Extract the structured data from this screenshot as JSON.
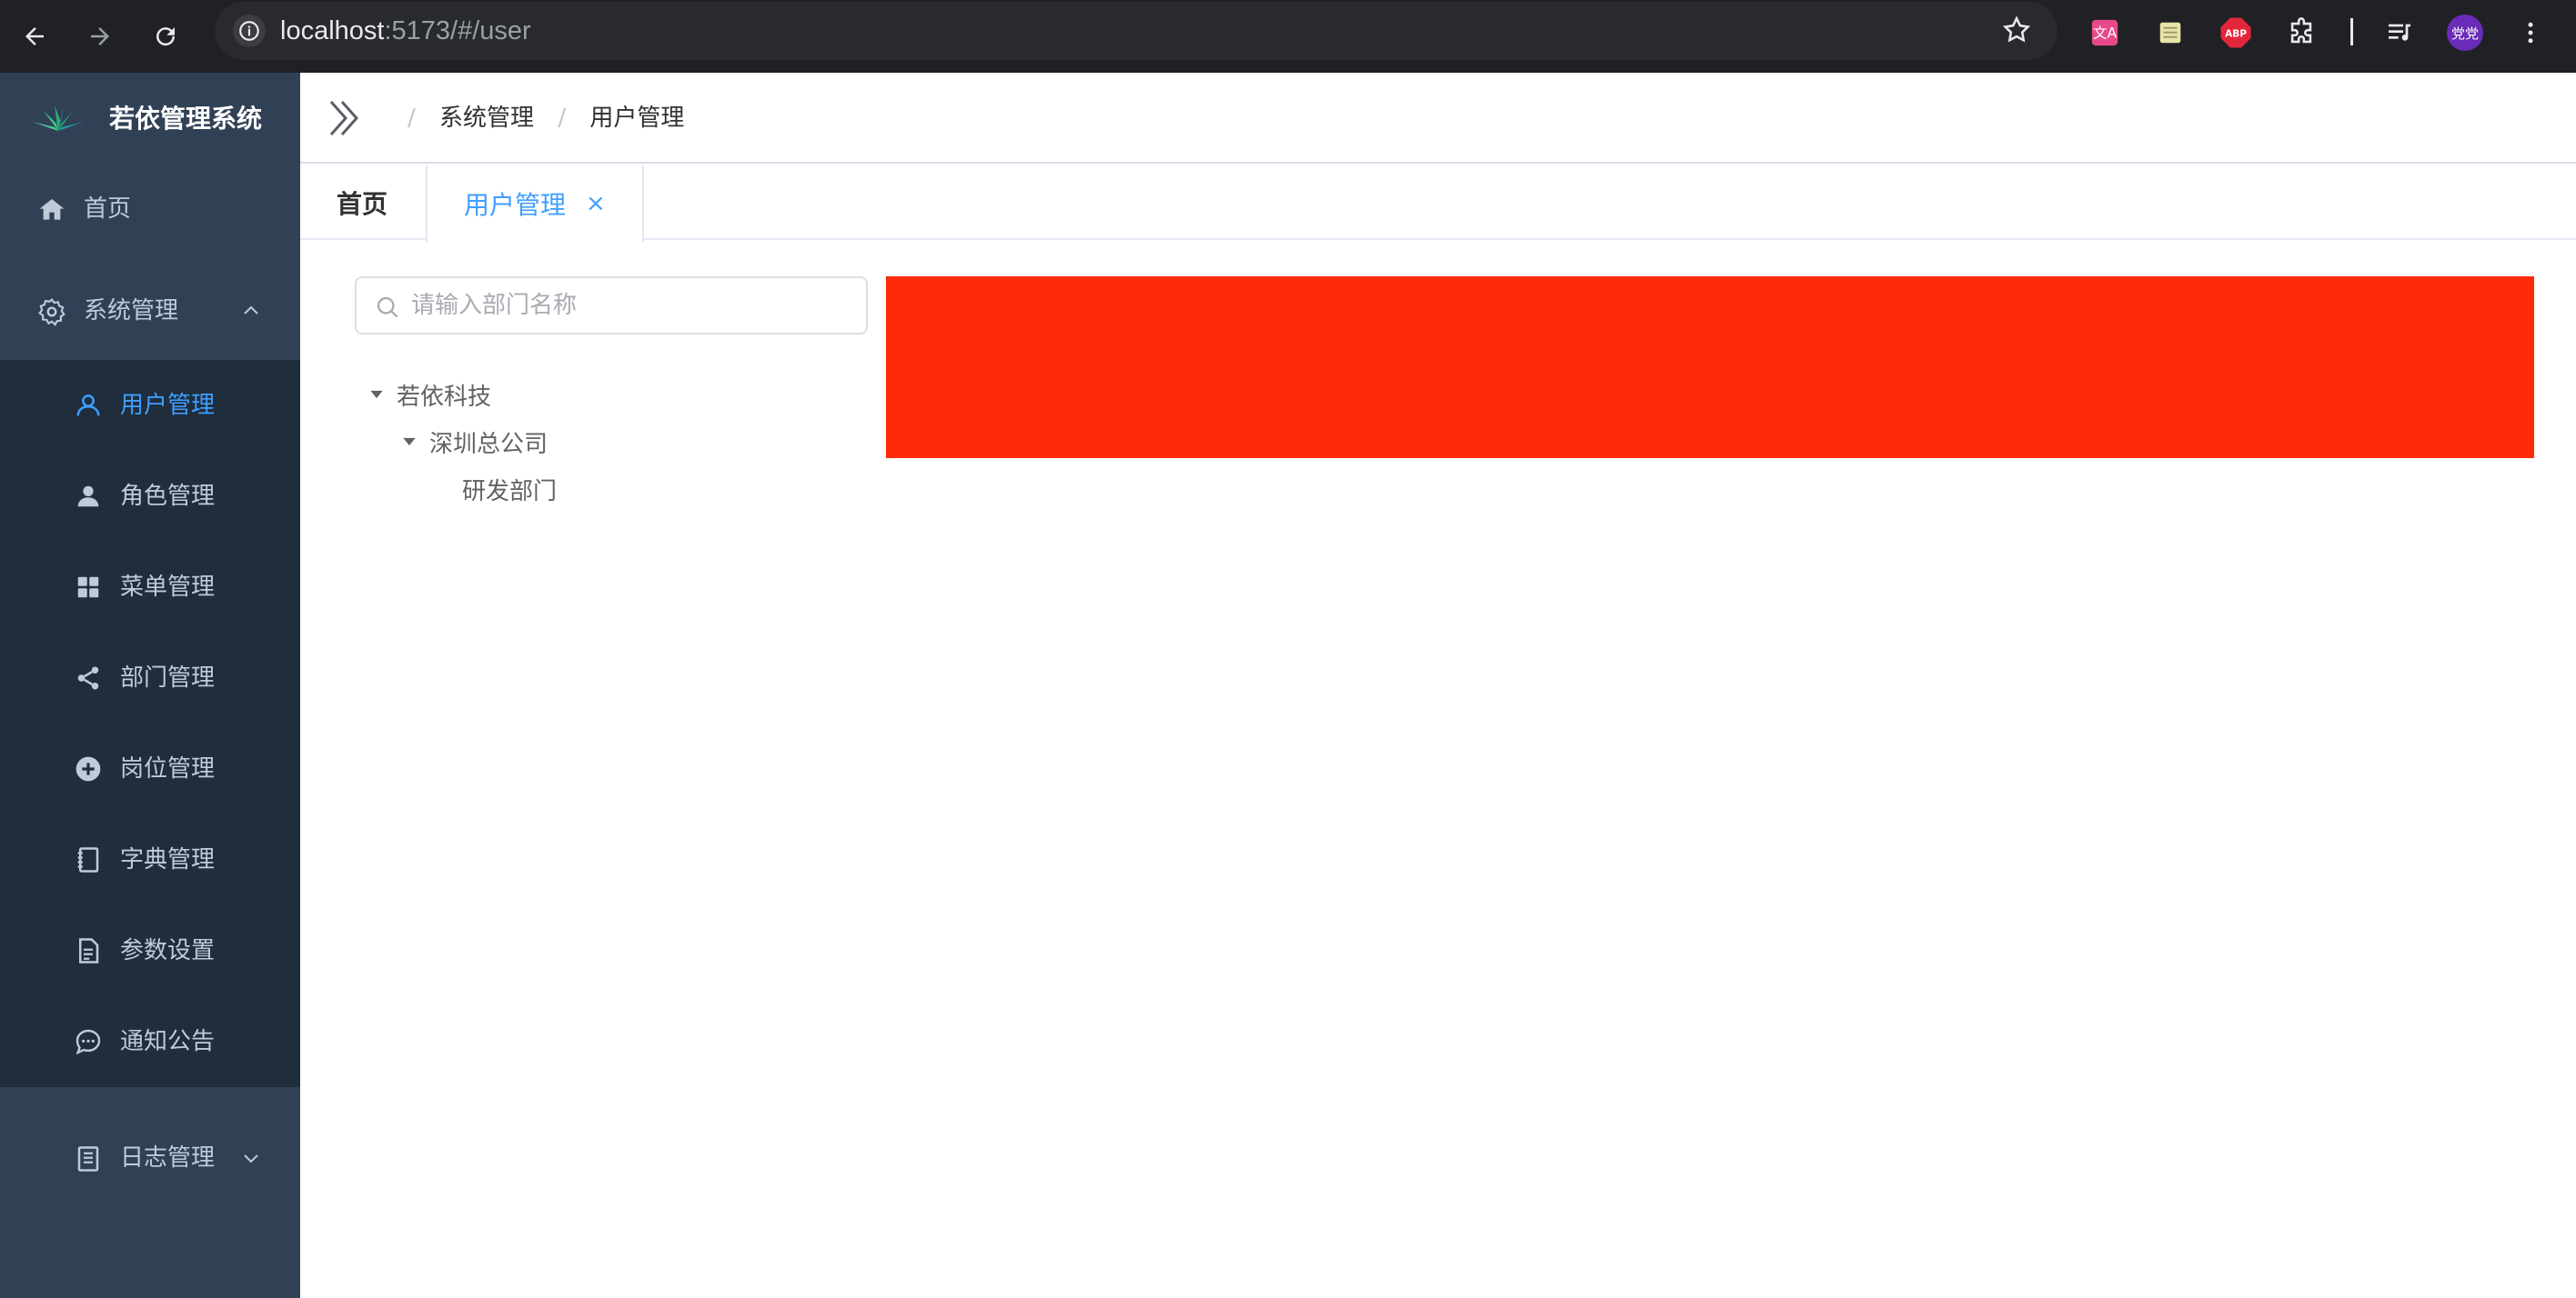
{
  "browser": {
    "url_host": "localhost",
    "url_rest": ":5173/#/user",
    "profile_text": "党党"
  },
  "sidebar": {
    "app_title": "若依管理系统",
    "items": [
      {
        "label": "首页",
        "icon": "home-icon"
      },
      {
        "label": "系统管理",
        "icon": "gear-icon",
        "expanded": true
      },
      {
        "label": "日志管理",
        "icon": "log-icon",
        "expanded": false
      }
    ],
    "sub_items": [
      {
        "label": "用户管理",
        "icon": "user-icon",
        "active": true
      },
      {
        "label": "角色管理",
        "icon": "role-icon"
      },
      {
        "label": "菜单管理",
        "icon": "grid-icon"
      },
      {
        "label": "部门管理",
        "icon": "share-icon"
      },
      {
        "label": "岗位管理",
        "icon": "plus-circle-icon"
      },
      {
        "label": "字典管理",
        "icon": "book-icon"
      },
      {
        "label": "参数设置",
        "icon": "doc-icon"
      },
      {
        "label": "通知公告",
        "icon": "chat-icon"
      }
    ]
  },
  "navbar": {
    "breadcrumb": [
      "系统管理",
      "用户管理"
    ],
    "separator": "/"
  },
  "tags": {
    "home": "首页",
    "active": "用户管理",
    "close": "×"
  },
  "dept_tree": {
    "placeholder": "请输入部门名称",
    "nodes": [
      {
        "label": "若依科技",
        "expanded": true
      },
      {
        "label": "深圳总公司",
        "expanded": true
      },
      {
        "label": "研发部门"
      }
    ]
  },
  "colors": {
    "sidebar_bg": "#304156",
    "submenu_bg": "#1f2d3d",
    "active": "#409eff",
    "redacted_block": "#ff2a0a"
  }
}
